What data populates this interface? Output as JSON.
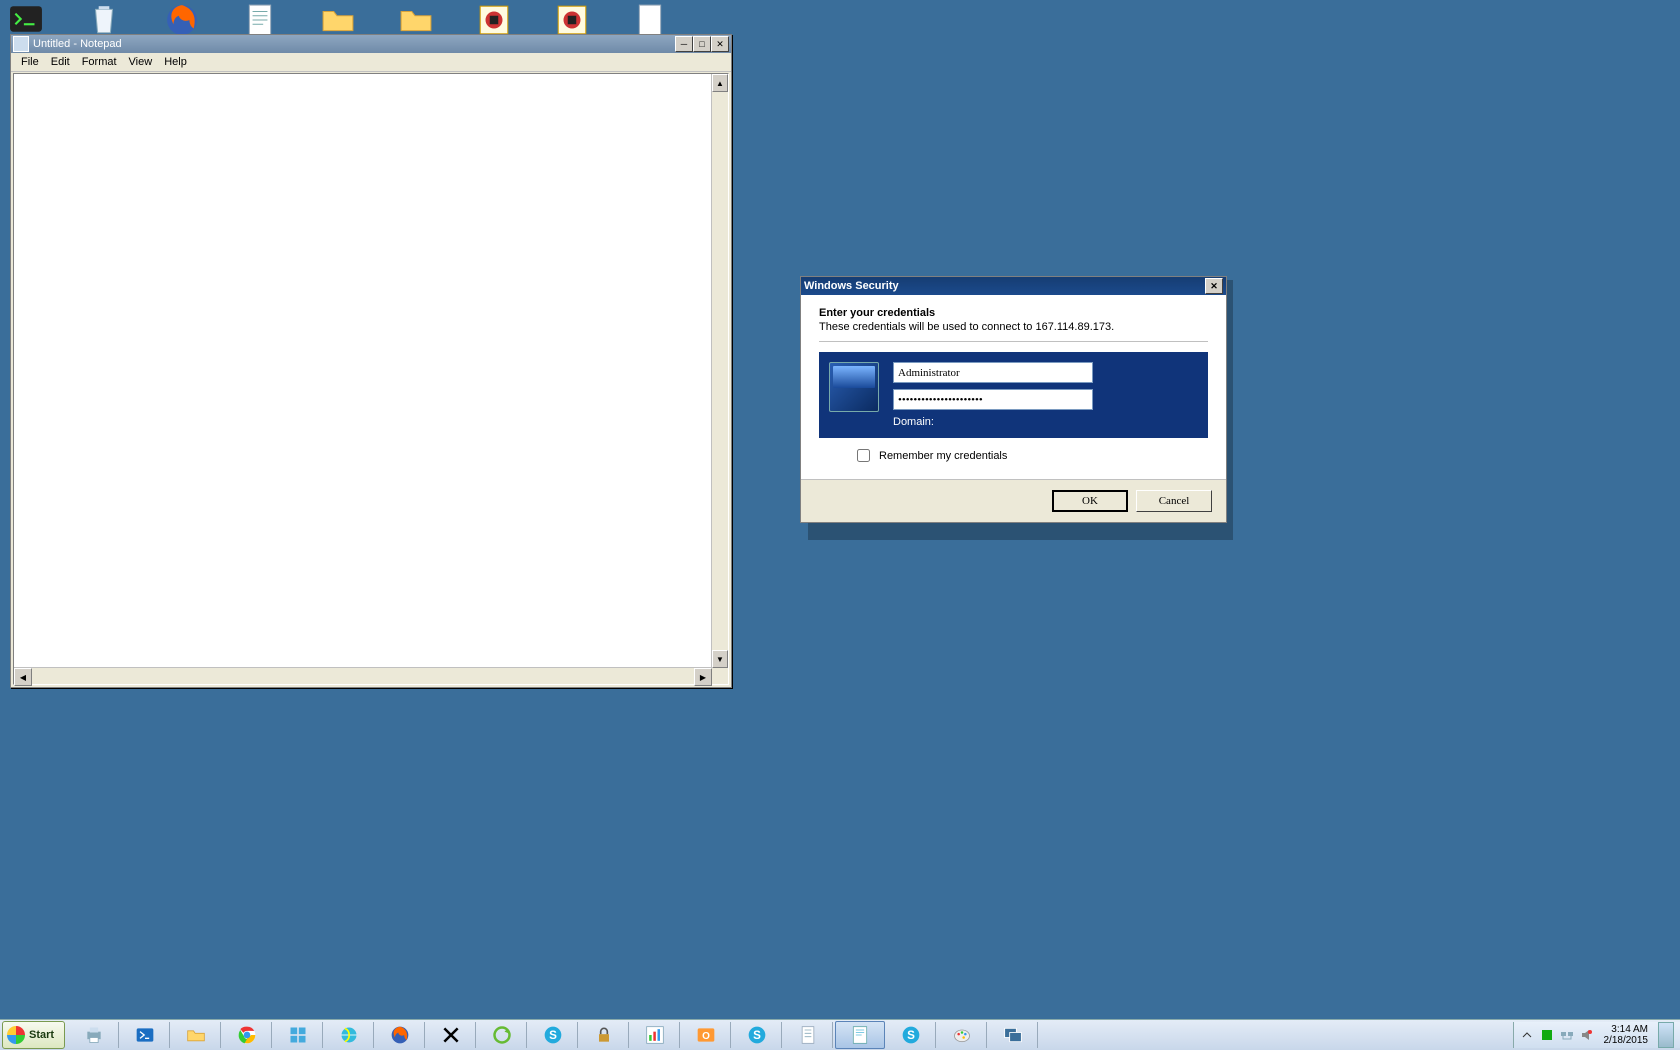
{
  "notepad": {
    "title": "Untitled - Notepad",
    "menu": {
      "file": "File",
      "edit": "Edit",
      "format": "Format",
      "view": "View",
      "help": "Help"
    }
  },
  "dialog": {
    "title": "Windows Security",
    "heading": "Enter your credentials",
    "subtext": "These credentials will be used to connect to 167.114.89.173.",
    "username_value": "Administrator",
    "password_value": "••••••••••••••••••••••",
    "domain_label": "Domain:",
    "remember_label": "Remember my credentials",
    "ok_label": "OK",
    "cancel_label": "Cancel"
  },
  "taskbar": {
    "start_label": "Start"
  },
  "tray": {
    "time": "3:14 AM",
    "date": "2/18/2015"
  }
}
